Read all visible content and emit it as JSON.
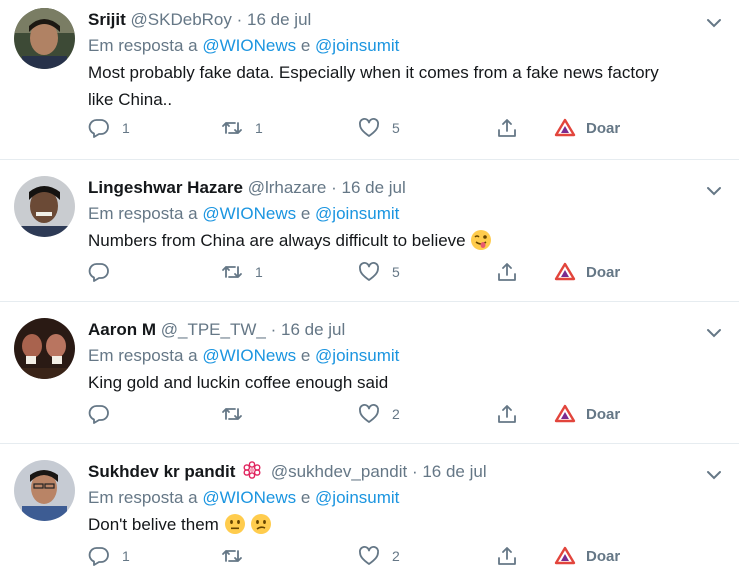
{
  "reply_prefix": "Em resposta a",
  "reply_conj": "e",
  "donate_label": "Doar",
  "colors": {
    "accent": "#1b95e0",
    "muted": "#657786",
    "text": "#14171a",
    "divider": "#e6ecf0",
    "brave": "#e2453c"
  },
  "tweets": [
    {
      "name": "Srijit",
      "handle": "@SKDebRoy",
      "date": "16 de jul",
      "mentions": [
        "@WIONews",
        "@joinsumit"
      ],
      "text_lines": [
        "Most probably fake data. Especially when it comes from a fake news factory",
        "like China.."
      ],
      "replies": "1",
      "retweets": "1",
      "likes": "5"
    },
    {
      "name": "Lingeshwar Hazare",
      "handle": "@lrhazare",
      "date": "16 de jul",
      "mentions": [
        "@WIONews",
        "@joinsumit"
      ],
      "text_lines": [
        "Numbers from China are always difficult to believe"
      ],
      "emojis": [
        "winking-face-tongue-icon"
      ],
      "replies": "",
      "retweets": "1",
      "likes": "5"
    },
    {
      "name": "Aaron M",
      "handle": "@_TPE_TW_",
      "date": "16 de jul",
      "mentions": [
        "@WIONews",
        "@joinsumit"
      ],
      "text_lines": [
        "King gold and luckin coffee enough said"
      ],
      "replies": "",
      "retweets": "",
      "likes": "2"
    },
    {
      "name": "Sukhdev kr pandit",
      "handle": "@sukhdev_pandit",
      "date": "16 de jul",
      "badge_icon": "flower-badge-icon",
      "mentions": [
        "@WIONews",
        "@joinsumit"
      ],
      "text_lines": [
        "Don't belive them"
      ],
      "emojis": [
        "neutral-face-icon",
        "confused-face-icon"
      ],
      "replies": "1",
      "retweets": "",
      "likes": "2"
    }
  ]
}
